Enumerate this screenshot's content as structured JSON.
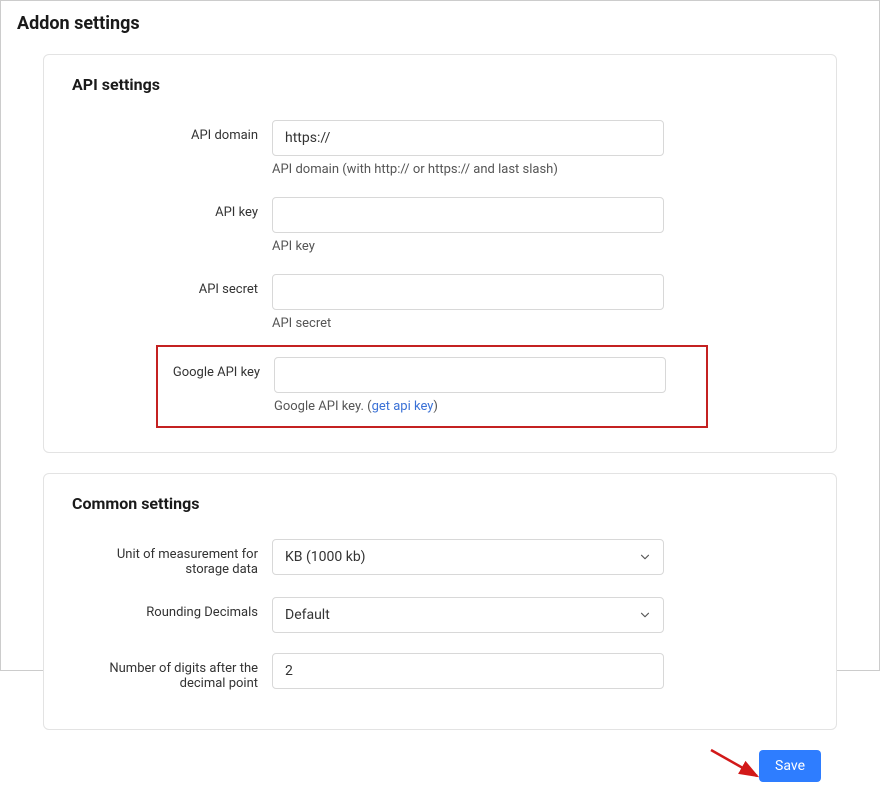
{
  "page_title": "Addon settings",
  "api_section": {
    "title": "API settings",
    "rows": {
      "api_domain": {
        "label": "API domain",
        "value": "https://",
        "hint": "API domain (with http:// or https:// and last slash)"
      },
      "api_key": {
        "label": "API key",
        "value": "",
        "hint": "API key"
      },
      "api_secret": {
        "label": "API secret",
        "value": "",
        "hint": "API secret"
      },
      "google_api_key": {
        "label": "Google API key",
        "value": "",
        "hint_prefix": "Google API key. (",
        "hint_link": "get api key",
        "hint_suffix": ")"
      }
    }
  },
  "common_section": {
    "title": "Common settings",
    "rows": {
      "unit": {
        "label": "Unit of measurement for storage data",
        "value": "KB (1000 kb)"
      },
      "rounding": {
        "label": "Rounding Decimals",
        "value": "Default"
      },
      "digits": {
        "label": "Number of digits after the decimal point",
        "value": "2"
      }
    }
  },
  "save_label": "Save"
}
